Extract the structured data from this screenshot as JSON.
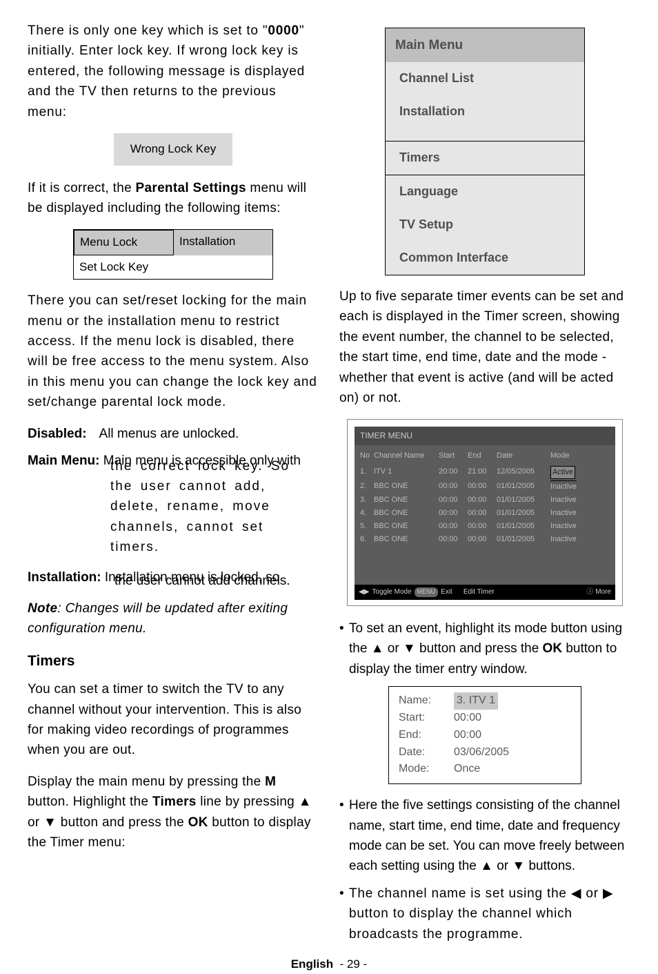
{
  "left": {
    "p1_a": "There is only one key which is set to \"",
    "p1_b": "0000",
    "p1_c": "\" initially. Enter lock key. If wrong lock key is entered, the following message is displayed and the TV then returns to the previous menu:",
    "wrong_key": "Wrong Lock Key",
    "p2_a": "If it is correct, the ",
    "p2_b": "Parental Settings",
    "p2_c": " menu will be displayed including the following items:",
    "settings": {
      "r1c1": "Menu Lock",
      "r1c2": "Installation",
      "r2c1": "Set Lock Key"
    },
    "p3": "There you can set/reset locking for the main menu or the installation menu to restrict access. If the menu lock is disabled, there will be free access to the menu system. Also in this menu you can change the lock key and set/change parental lock mode.",
    "disabled_label": "Disabled:",
    "disabled_body": "All menus are unlocked.",
    "main_menu_label": "Main Menu:",
    "main_menu_body_1": "Main menu is accessible only with",
    "main_menu_body_2": "the correct lock key. So the user cannot add, delete, rename, move channels, cannot set timers.",
    "inst_label": "Installation:",
    "inst_body_1": "Installation menu is locked, so",
    "inst_body_2": "the user cannot add channels.",
    "note_label": "Note",
    "note_body": ": Changes will be updated after exiting configuration menu.",
    "timers_heading": "Timers",
    "p4": "You can set a timer to switch the TV to any channel without your intervention. This is also for making video recordings of programmes when you are out.",
    "p5_a": "Display the main menu by pressing the ",
    "p5_b": "M",
    "p5_c": " button. Highlight the ",
    "p5_d": "Timers",
    "p5_e": " line by pressing ▲ or ▼ button and press the ",
    "p5_f": "OK",
    "p5_g": " button to display the Timer menu:"
  },
  "right": {
    "menu": {
      "title": "Main Menu",
      "items": [
        "Channel List",
        "Installation",
        "Timers",
        "Language",
        "TV Setup",
        "Common Interface"
      ]
    },
    "p1": "Up to five separate timer events can be set and each is displayed in the Timer screen, showing the event number, the channel to be selected, the start time, end time, date and the mode - whether that event is active (and will be acted on) or not.",
    "timer_title": "TIMER MENU",
    "timer_header": {
      "no": "No",
      "name": "Channel Name",
      "start": "Start",
      "end": "End",
      "date": "Date",
      "mode": "Mode"
    },
    "timer_rows": [
      {
        "no": "1.",
        "name": "ITV 1",
        "start": "20:00",
        "end": "21:00",
        "date": "12/05/2005",
        "mode": "Active"
      },
      {
        "no": "2.",
        "name": "BBC ONE",
        "start": "00:00",
        "end": "00:00",
        "date": "01/01/2005",
        "mode": "Inactive"
      },
      {
        "no": "3.",
        "name": "BBC ONE",
        "start": "00:00",
        "end": "00:00",
        "date": "01/01/2005",
        "mode": "Inactive"
      },
      {
        "no": "4.",
        "name": "BBC ONE",
        "start": "00:00",
        "end": "00:00",
        "date": "01/01/2005",
        "mode": "Inactive"
      },
      {
        "no": "5.",
        "name": "BBC ONE",
        "start": "00:00",
        "end": "00:00",
        "date": "01/01/2005",
        "mode": "Inactive"
      },
      {
        "no": "6.",
        "name": "BBC ONE",
        "start": "00:00",
        "end": "00:00",
        "date": "01/01/2005",
        "mode": "Inactive"
      }
    ],
    "footer_toggle": "Toggle Mode",
    "footer_exit": "Exit",
    "footer_edit": "Edit Timer",
    "footer_more": "More",
    "footer_nav": "◀▶",
    "footer_menu_pill": "MENU",
    "footer_green_pill": " ",
    "footer_info": "ⓘ",
    "bullet1_a": "To set an event, highlight its mode button using the ▲ or ▼ button and press the ",
    "bullet1_b": "OK",
    "bullet1_c": " button to display the timer entry window.",
    "entry": {
      "name_l": "Name:",
      "name_v": "3. ITV 1",
      "start_l": "Start:",
      "start_v": "00:00",
      "end_l": "End:",
      "end_v": "00:00",
      "date_l": "Date:",
      "date_v": "03/06/2005",
      "mode_l": "Mode:",
      "mode_v": "Once"
    },
    "bullet2": "Here the five settings consisting of the channel name, start time, end time, date and frequency mode can be set. You can move freely between each setting using the ▲ or ▼ buttons.",
    "bullet3": "The channel name is set using the ◀ or ▶ button to display the channel which broadcasts the programme."
  },
  "footer": {
    "lang": "English",
    "page": "- 29 -"
  }
}
